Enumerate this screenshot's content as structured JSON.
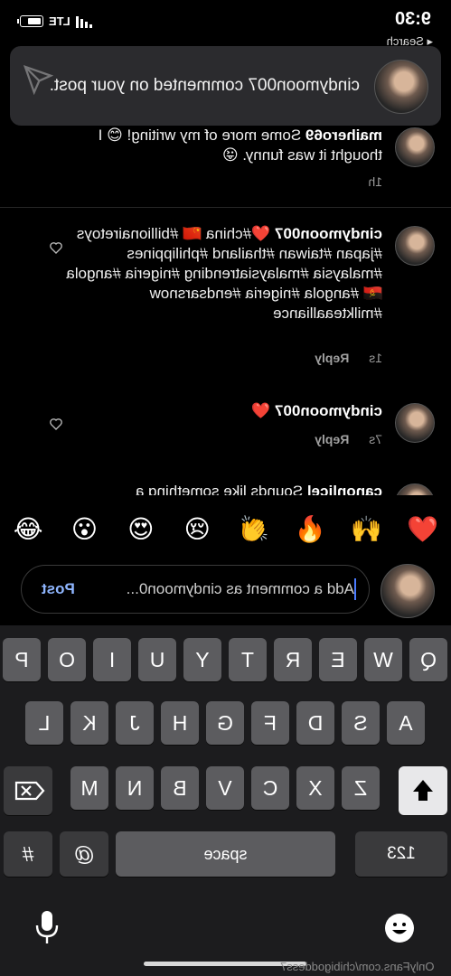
{
  "status": {
    "time": "9:30",
    "back": "◂ Search",
    "network": "LTE"
  },
  "banner": {
    "text": "cindymoon007 commented on your post."
  },
  "comments": [
    {
      "username": "maihero69",
      "text": " Some more of my writing! 😊 I thought it was funny. 😜",
      "time": "1h",
      "reply": ""
    },
    {
      "username": "cindymoon007",
      "text": " ❤️#china 🇨🇳 #billionairetoys #japan #taiwan #thailand #philippines #malaysia #malaysiatrending #nigeria #angola 🇦🇴 #angola #nigeria #endsarsnow #milkteaalliance",
      "time": "1s",
      "reply": "Reply"
    },
    {
      "username": "cindymoon007",
      "text": " ❤️",
      "time": "7s",
      "reply": "Reply"
    },
    {
      "username": "canonlicel",
      "text": " Sounds like something a",
      "time": "",
      "reply": ""
    }
  ],
  "emojis": [
    "❤️",
    "🙌",
    "🔥",
    "👏",
    "😢",
    "😍",
    "😮",
    "😂"
  ],
  "composer": {
    "placeholder": "Add a comment as cindymoon0...",
    "post": "Post"
  },
  "keyboard": {
    "row1": [
      "Q",
      "W",
      "E",
      "R",
      "T",
      "Y",
      "U",
      "I",
      "O",
      "P"
    ],
    "row2": [
      "A",
      "S",
      "D",
      "F",
      "G",
      "H",
      "J",
      "K",
      "L"
    ],
    "row3": [
      "Z",
      "X",
      "C",
      "V",
      "B",
      "N",
      "M"
    ],
    "numbers": "123",
    "space": "space",
    "at": "@",
    "hash": "#"
  },
  "watermark": "OnlyFans.com/chibigoddess7"
}
